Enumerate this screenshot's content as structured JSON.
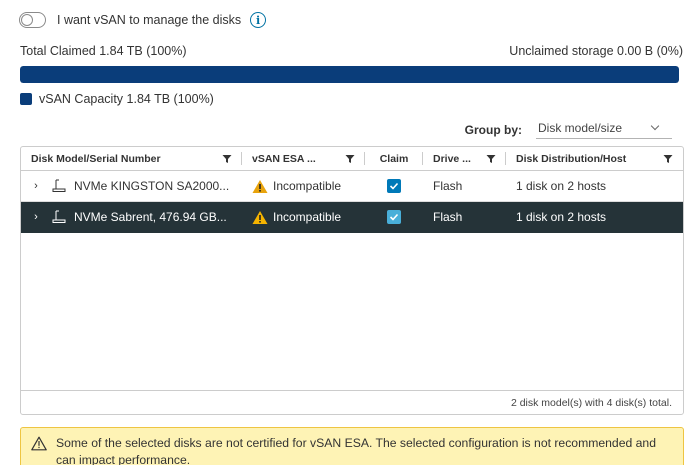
{
  "toggle": {
    "label": "I want vSAN to manage the disks",
    "checked": false
  },
  "info_icon": "info-icon",
  "capacity": {
    "total_claimed": "Total Claimed 1.84 TB (100%)",
    "unclaimed": "Unclaimed storage 0.00 B (0%)",
    "claimed_fraction": 1.0,
    "bar_color": "#0a3d7a",
    "legend_label": "vSAN Capacity 1.84 TB (100%)"
  },
  "group_by": {
    "label": "Group by:",
    "selected": "Disk model/size"
  },
  "table": {
    "columns": [
      {
        "label": "Disk Model/Serial Number",
        "filter": true
      },
      {
        "label": "vSAN ESA ...",
        "filter": true
      },
      {
        "label": "Claim",
        "filter": false
      },
      {
        "label": "Drive ...",
        "filter": true
      },
      {
        "label": "Disk Distribution/Host",
        "filter": true
      }
    ],
    "rows": [
      {
        "model": "NVMe KINGSTON SA2000...",
        "esa": "Incompatible",
        "claimed": true,
        "drive": "Flash",
        "distribution": "1 disk on 2 hosts",
        "selected": false
      },
      {
        "model": "NVMe Sabrent, 476.94 GB...",
        "esa": "Incompatible",
        "claimed": true,
        "drive": "Flash",
        "distribution": "1 disk on 2 hosts",
        "selected": true
      }
    ],
    "footer": "2 disk model(s) with 4 disk(s) total."
  },
  "alert": {
    "text": "Some of the selected disks are not certified for vSAN ESA. The selected configuration is not recommended and can impact performance.",
    "color": "#fef3b5"
  }
}
